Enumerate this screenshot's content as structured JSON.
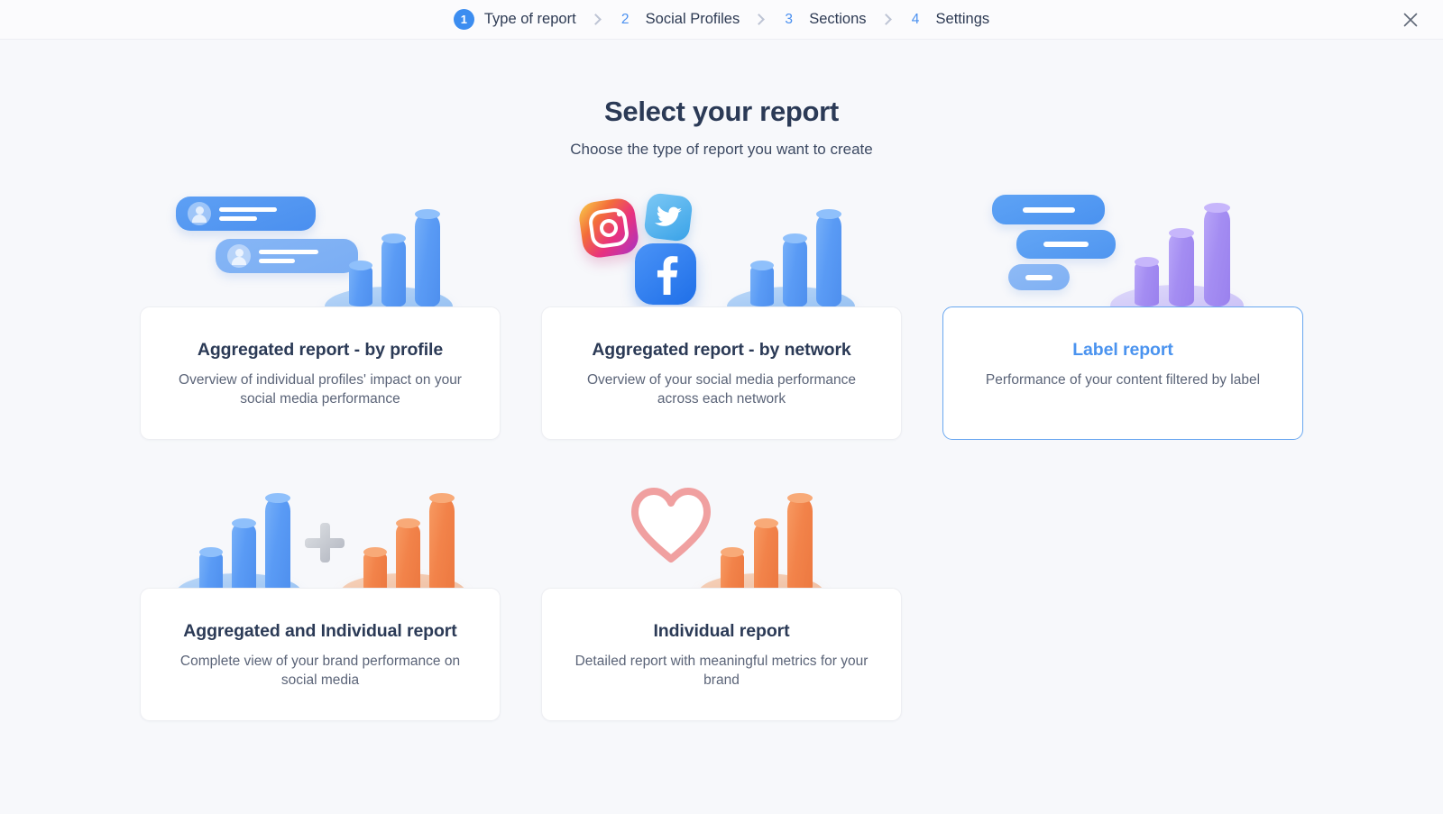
{
  "header": {
    "steps": [
      {
        "number": "1",
        "label": "Type of report",
        "active": true
      },
      {
        "number": "2",
        "label": "Social Profiles",
        "active": false
      },
      {
        "number": "3",
        "label": "Sections",
        "active": false
      },
      {
        "number": "4",
        "label": "Settings",
        "active": false
      }
    ],
    "close_icon": "close-icon"
  },
  "main": {
    "title": "Select your report",
    "subtitle": "Choose the type of report you want to create",
    "cards": [
      {
        "title": "Aggregated report - by profile",
        "description": "Overview of individual profiles' impact on your social media performance",
        "selected": false,
        "illustration": "profiles-and-blue-bars"
      },
      {
        "title": "Aggregated report - by network",
        "description": "Overview of your social media performance across each network",
        "selected": false,
        "illustration": "social-networks-and-blue-bars"
      },
      {
        "title": "Label report",
        "description": "Performance of your content filtered by label",
        "selected": true,
        "illustration": "labels-and-purple-bars"
      },
      {
        "title": "Aggregated and Individual report",
        "description": "Complete view of your brand performance on social media",
        "selected": false,
        "illustration": "blue-bars-plus-orange-bars"
      },
      {
        "title": "Individual report",
        "description": "Detailed report with meaningful metrics for your brand",
        "selected": false,
        "illustration": "heart-and-orange-bars"
      }
    ]
  },
  "colors": {
    "page_background": "#f7f8fb",
    "accent_blue": "#3c8df0",
    "selected_border": "#69a7f0",
    "title_navy": "#2b3a56",
    "body_gray": "#5b6478",
    "bar_blue": "#5a9bf5",
    "bar_purple": "#a48df2",
    "bar_orange": "#f2834a"
  }
}
